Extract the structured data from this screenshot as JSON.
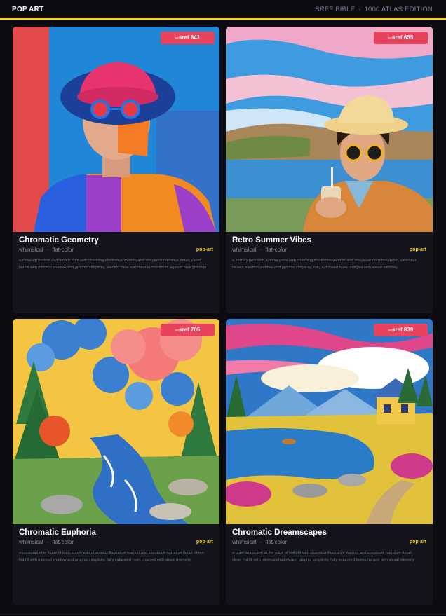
{
  "header": {
    "brand": "POP ART",
    "publication": "SREF BIBLE",
    "separator": "·",
    "edition": "1000 ATLAS EDITION"
  },
  "cards": [
    {
      "sref": "--sref 641",
      "title": "Chromatic Geometry",
      "tag1": "whimsical",
      "tag2": "flat-color",
      "separator": "·",
      "category": "pop-art",
      "description": "a close-up portrait in dramatic light with charming illustrative warmth and storybook narrative detail, clean flat fill with minimal shadow and graphic simplicity, electric color saturated to maximum against dark grounds"
    },
    {
      "sref": "--sref 655",
      "title": "Retro Summer Vibes",
      "tag1": "whimsical",
      "tag2": "flat-color",
      "separator": "·",
      "category": "pop-art",
      "description": "a solitary face with intense gaze with charming illustrative warmth and storybook narrative detail, clean flat fill with minimal shadow and graphic simplicity, fully saturated hues charged with visual intensity"
    },
    {
      "sref": "--sref 705",
      "title": "Chromatic Euphoria",
      "tag1": "whimsical",
      "tag2": "flat-color",
      "separator": "·",
      "category": "pop-art",
      "description": "a contemplative figure lit from above with charming illustrative warmth and storybook narrative detail, clean flat fill with minimal shadow and graphic simplicity, fully saturated hues charged with visual intensity"
    },
    {
      "sref": "--sref 839",
      "title": "Chromatic Dreamscapes",
      "tag1": "whimsical",
      "tag2": "flat-color",
      "separator": "·",
      "category": "pop-art",
      "description": "a quiet landscape at the edge of twilight with charming illustrative warmth and storybook narrative detail, clean flat fill with minimal shadow and graphic simplicity, fully saturated hues charged with visual intensity"
    }
  ],
  "colors": {
    "accent_yellow": "#f3d21b",
    "badge_red": "#e8435c",
    "card_bg": "#14141d",
    "page_bg": "#0b0b10"
  }
}
